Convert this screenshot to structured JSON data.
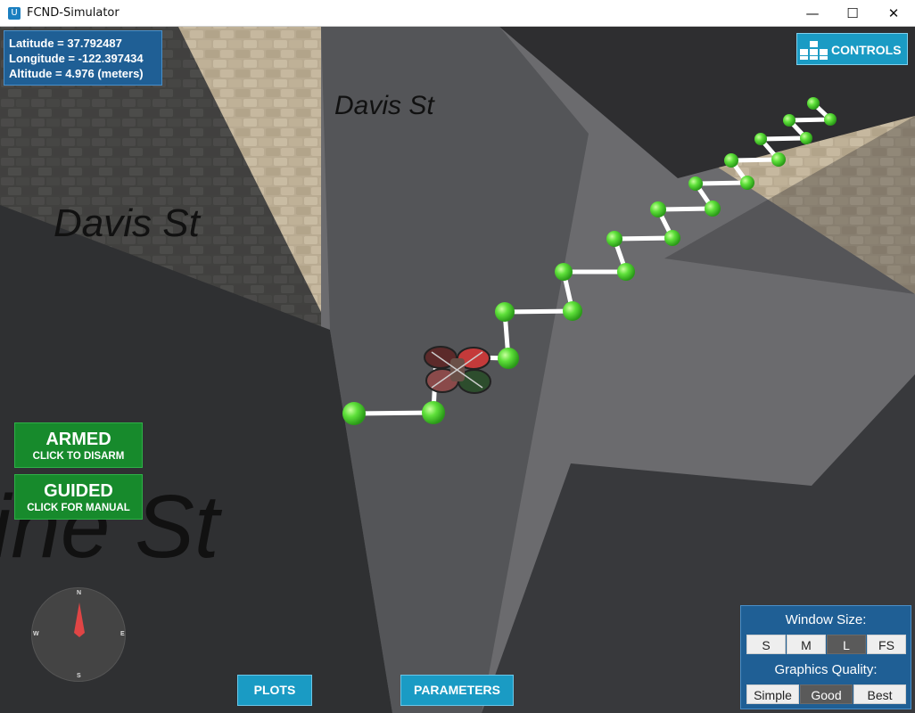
{
  "window": {
    "title": "FCND-Simulator",
    "icon": "unity-icon",
    "buttons": {
      "minimize": "—",
      "maximize": "☐",
      "close": "✕"
    }
  },
  "gps": {
    "latitude": "Latitude = 37.792487",
    "longitude": "Longitude = -122.397434",
    "altitude": "Altitude = 4.976 (meters)"
  },
  "controls_button": {
    "label": "CONTROLS",
    "icon": "controls-grid-icon"
  },
  "street_labels": {
    "upper": "Davis St",
    "middle": "Davis St",
    "lower": "ine St"
  },
  "armed_button": {
    "title": "ARMED",
    "subtitle": "CLICK TO DISARM"
  },
  "guided_button": {
    "title": "GUIDED",
    "subtitle": "CLICK FOR MANUAL"
  },
  "compass": {
    "north": "N",
    "south": "S",
    "east": "E",
    "west": "W"
  },
  "bottom_buttons": {
    "plots": "PLOTS",
    "parameters": "PARAMETERS"
  },
  "window_size": {
    "header": "Window Size:",
    "options": [
      "S",
      "M",
      "L",
      "FS"
    ],
    "selected": "L"
  },
  "graphics_quality": {
    "header": "Graphics Quality:",
    "options": [
      "Simple",
      "Good",
      "Best"
    ],
    "selected": "Good"
  },
  "colors": {
    "panel_blue": "#1f5f95",
    "button_cyan": "#1a9bc4",
    "armed_green": "#178a2c",
    "waypoint_green": "#5ee03a"
  }
}
